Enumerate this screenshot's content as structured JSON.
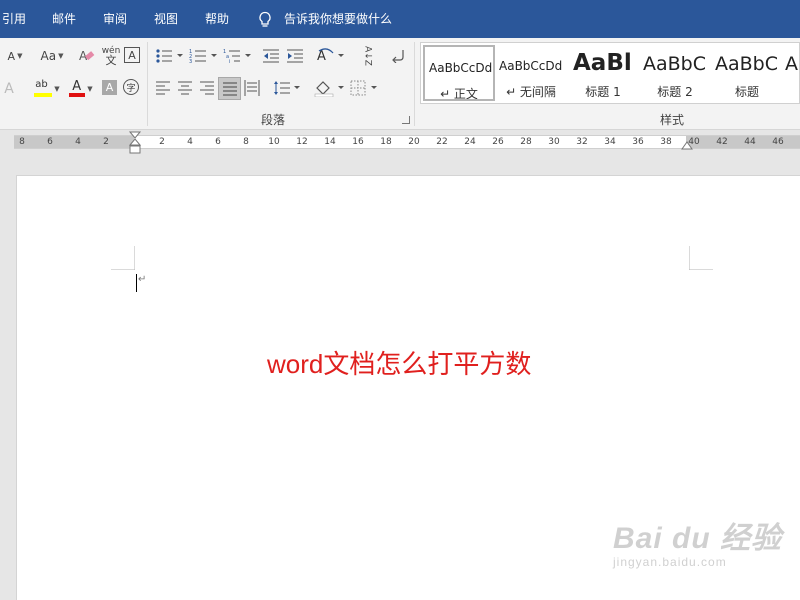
{
  "tabs": [
    "引用",
    "邮件",
    "审阅",
    "视图",
    "帮助"
  ],
  "tell_me": "告诉我你想要做什么",
  "font_group": {
    "icons": [
      "font-size-decrease-icon",
      "change-case-icon",
      "clear-formatting-icon",
      "phonetic-guide-icon",
      "character-border-icon",
      "text-effects-icon",
      "text-highlight-icon",
      "font-color-icon",
      "character-shading-icon",
      "enclose-characters-icon"
    ],
    "case_label": "Aa",
    "phonetic_top": "wén",
    "phonetic_bottom": "文",
    "border_char": "A",
    "font_color_char": "A",
    "shading_char": "A",
    "enclose_char": "字",
    "highlight_char": "ab",
    "highlight_color": "#ffff00",
    "font_color": "#e01010"
  },
  "paragraph_group": {
    "label": "段落",
    "icons": [
      "bullets-icon",
      "numbering-icon",
      "multilevel-list-icon",
      "decrease-indent-icon",
      "increase-indent-icon",
      "chinese-layout-icon",
      "sort-icon",
      "show-marks-icon",
      "align-left-icon",
      "center-icon",
      "align-right-icon",
      "justify-icon",
      "distributed-icon",
      "line-spacing-icon",
      "shading-icon",
      "borders-icon"
    ],
    "sort_label": "A↓Z"
  },
  "styles_group": {
    "label": "样式",
    "items": [
      {
        "sample": "AaBbCcDd",
        "name": "↵ 正文",
        "selected": true
      },
      {
        "sample": "AaBbCcDd",
        "name": "↵ 无间隔",
        "selected": false
      },
      {
        "sample": "AaBl",
        "name": "标题 1",
        "selected": false
      },
      {
        "sample": "AaBbC",
        "name": "标题 2",
        "selected": false
      },
      {
        "sample": "AaBbC",
        "name": "标题",
        "selected": false
      },
      {
        "sample": "A",
        "name": "",
        "selected": false
      }
    ]
  },
  "ruler": {
    "left_numbers": [
      "8",
      "6",
      "4",
      "2"
    ],
    "right_numbers": [
      "2",
      "4",
      "6",
      "8",
      "10",
      "12",
      "14",
      "16",
      "18",
      "20",
      "22",
      "24",
      "26",
      "28",
      "30",
      "32",
      "34",
      "36",
      "38",
      "40",
      "42",
      "44",
      "46"
    ]
  },
  "document": {
    "paragraph_mark": "↵",
    "text": "word文档怎么打平方数",
    "text_color": "#e0201e"
  },
  "watermark": {
    "top": "Bai du 经验",
    "url": "jingyan.baidu.com"
  },
  "colors": {
    "tabbar": "#2b579a",
    "ribbon": "#f3f3f3",
    "workspace": "#e6e6e6"
  }
}
